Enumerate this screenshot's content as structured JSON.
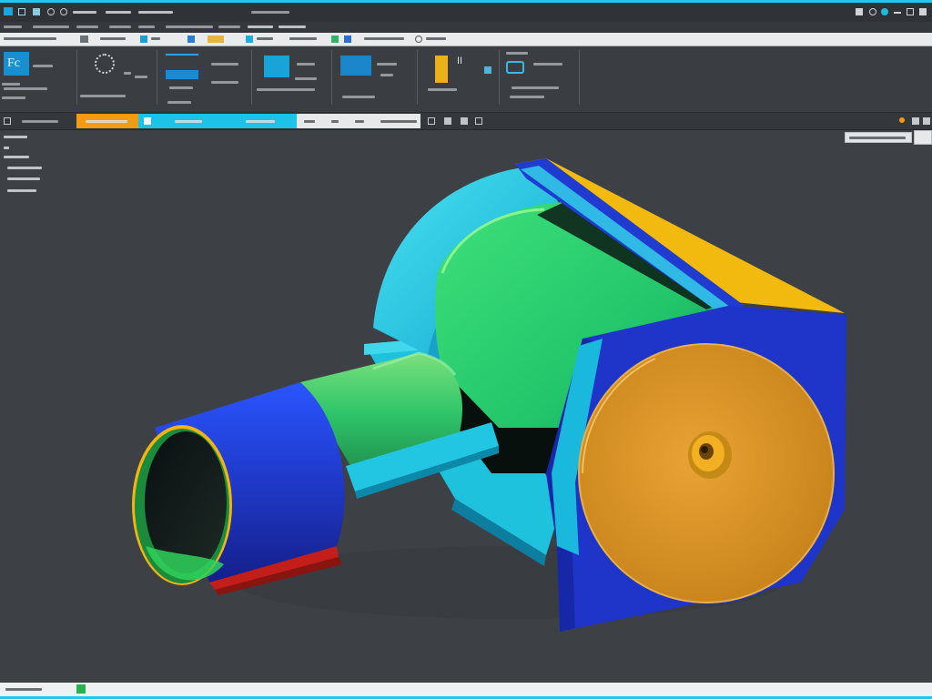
{
  "ribbon": {
    "sketch_badge": "Fc",
    "small_tool_label": "II"
  },
  "colors": {
    "accent": "#22c8e8",
    "highlight_tab": "#f39c12",
    "part_blue": "#1f3bd0",
    "part_green": "#26d16a",
    "part_cyan": "#1fd2e8",
    "part_orange": "#e19a25",
    "part_yellow": "#f2b90f",
    "part_red": "#d9261c",
    "background": "#3d4145"
  }
}
